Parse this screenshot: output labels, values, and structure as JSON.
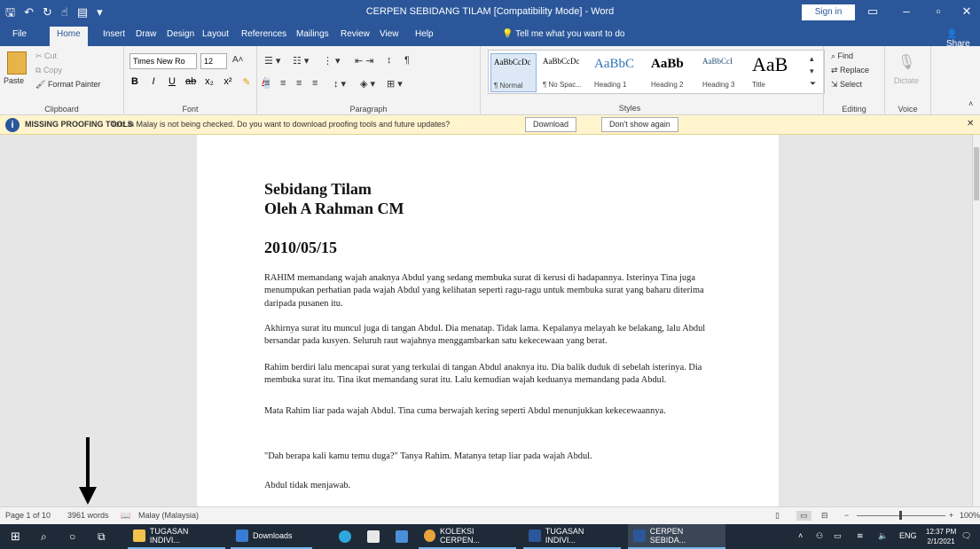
{
  "window": {
    "title": "CERPEN SEBIDANG TILAM [Compatibility Mode] - Word",
    "sign_in": "Sign in"
  },
  "tabs": [
    "File",
    "Home",
    "Insert",
    "Draw",
    "Design",
    "Layout",
    "References",
    "Mailings",
    "Review",
    "View",
    "Help"
  ],
  "tell_me": "Tell me what you want to do",
  "share": "Share",
  "ribbon": {
    "clipboard": {
      "label": "Clipboard",
      "paste": "Paste",
      "cut": "Cut",
      "copy": "Copy",
      "format_painter": "Format Painter"
    },
    "font": {
      "label": "Font",
      "family": "Times New Ro",
      "size": "12"
    },
    "paragraph": {
      "label": "Paragraph"
    },
    "styles": {
      "label": "Styles",
      "items": [
        {
          "preview": "AaBbCcDc",
          "name": "¶ Normal"
        },
        {
          "preview": "AaBbCcDc",
          "name": "¶ No Spac..."
        },
        {
          "preview": "AaBbC",
          "name": "Heading 1"
        },
        {
          "preview": "AaBb",
          "name": "Heading 2"
        },
        {
          "preview": "AaBbCcI",
          "name": "Heading 3"
        },
        {
          "preview": "AaB",
          "name": "Title"
        }
      ]
    },
    "editing": {
      "label": "Editing",
      "find": "Find",
      "replace": "Replace",
      "select": "Select"
    },
    "voice": {
      "label": "Voice",
      "dictate": "Dictate"
    }
  },
  "infobar": {
    "title": "MISSING PROOFING TOOLS",
    "message": "Text in Malay is not being checked. Do you want to download proofing tools and future updates?",
    "download": "Download",
    "dont_show": "Don't show again"
  },
  "document": {
    "title_line1": "Sebidang Tilam",
    "title_line2": "Oleh A Rahman CM",
    "date": "2010/05/15",
    "paragraphs": [
      "RAHIM memandang wajah anaknya Abdul yang sedang membuka surat di kerusi di hadapannya. Isterinya Tina juga menumpukan perhatian pada wajah Abdul yang kelihatan seperti ragu-ragu untuk membuka surat yang baharu diterima daripada pusanen itu.",
      "Akhirnya surat itu muncul juga di tangan Abdul. Dia menatap. Tidak lama. Kepalanya melayah ke belakang, lalu Abdul bersandar pada kusyen. Seluruh raut wajahnya menggambarkan satu kekecewaan yang berat.",
      "Rahim berdiri lalu mencapai surat yang terkulai di tangan Abdul anaknya itu. Dia balik duduk di sebelah isterinya. Dia membuka surat itu. Tina ikut memandang surat itu. Lalu kemudian wajah keduanya memandang pada Abdul.",
      "Mata Rahim liar pada wajah Abdul. Tina cuma berwajah kering seperti Abdul menunjukkan kekecewaannya.",
      "\"Dah berapa kali kamu temu duga?\" Tanya Rahim. Matanya tetap liar pada wajah Abdul.",
      "Abdul tidak menjawab."
    ]
  },
  "status": {
    "page": "Page 1 of 10",
    "words": "3961 words",
    "language": "Malay (Malaysia)",
    "zoom": "100%"
  },
  "taskbar": {
    "items": [
      "TUGASAN INDIVI...",
      "Downloads",
      "KOLEKSI CERPEN...",
      "TUGASAN INDIVI...",
      "CERPEN SEBIDA..."
    ],
    "lang": "ENG",
    "time": "12:37 PM",
    "date": "2/1/2021"
  }
}
